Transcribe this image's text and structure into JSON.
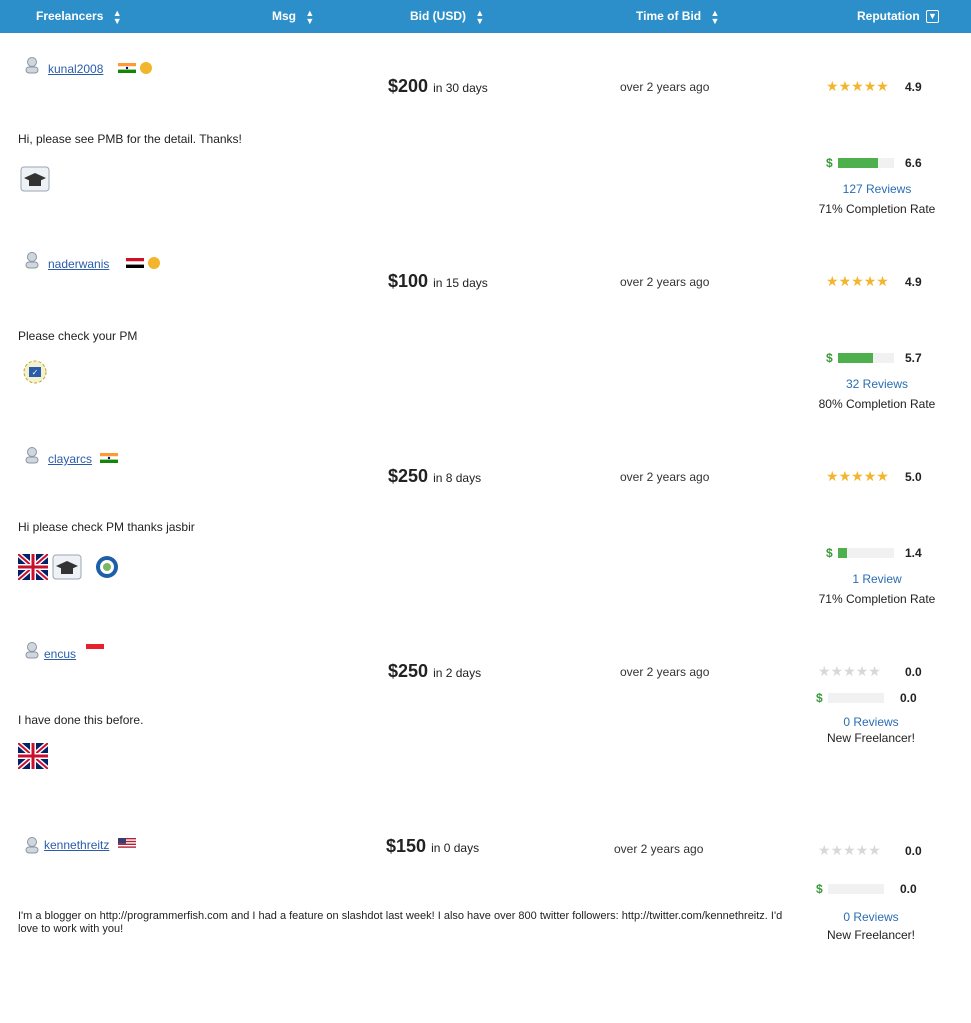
{
  "header": {
    "freelancers": "Freelancers",
    "msg": "Msg",
    "bid": "Bid (USD)",
    "time": "Time of Bid",
    "reputation": "Reputation"
  },
  "colors": {
    "header_bg": "#2d8fc9",
    "link": "#2a5caa",
    "star": "#f3b52b",
    "bar": "#4db04d"
  },
  "rows": [
    {
      "username": "kunal2008",
      "flag": "India",
      "bid": "$200",
      "days": "in 30 days",
      "time": "over 2 years ago",
      "message": "Hi, please see PMB for the detail. Thanks!",
      "stars": 4.9,
      "rating": "4.9",
      "score": "6.6",
      "score_fraction": 0.66,
      "reviews": "127 Reviews",
      "completion": "71% Completion Rate",
      "badges": [
        "graduate-cap-icon"
      ]
    },
    {
      "username": "naderwanis",
      "flag": "Egypt",
      "bid": "$100",
      "days": "in 15 days",
      "time": "over 2 years ago",
      "message": "Please check your PM",
      "stars": 4.9,
      "rating": "4.9",
      "score": "5.7",
      "score_fraction": 0.57,
      "reviews": "32 Reviews",
      "completion": "80% Completion Rate",
      "badges": [
        "certified-gear-icon"
      ]
    },
    {
      "username": "clayarcs",
      "flag": "India",
      "bid": "$250",
      "days": "in 8 days",
      "time": "over 2 years ago",
      "message": "Hi please check PM thanks jasbir",
      "stars": 5.0,
      "rating": "5.0",
      "score": "1.4",
      "score_fraction": 0.14,
      "reviews": "1 Review",
      "completion": "71% Completion Rate",
      "badges": [
        "uk-flag-icon",
        "graduate-cap-icon",
        "seal-icon"
      ]
    },
    {
      "username": "encus",
      "flag": "Indonesia",
      "bid": "$250",
      "days": "in 2 days",
      "time": "over 2 years ago",
      "message": "I have done this before.",
      "stars": 0,
      "rating": "0.0",
      "score": "0.0",
      "score_fraction": 0,
      "reviews": "0 Reviews",
      "completion": "New Freelancer!",
      "badges": [
        "uk-flag-icon"
      ]
    },
    {
      "username": "kennethreitz",
      "flag": "USA",
      "bid": "$150",
      "days": "in 0 days",
      "time": "over 2 years ago",
      "message": "I'm a blogger on http://programmerfish.com and I had a feature on slashdot last week! I also have over 800 twitter followers: http://twitter.com/kennethreitz. I'd love to work with you!",
      "stars": 0,
      "rating": "0.0",
      "score": "0.0",
      "score_fraction": 0,
      "reviews": "0 Reviews",
      "completion": "New Freelancer!",
      "badges": []
    }
  ]
}
